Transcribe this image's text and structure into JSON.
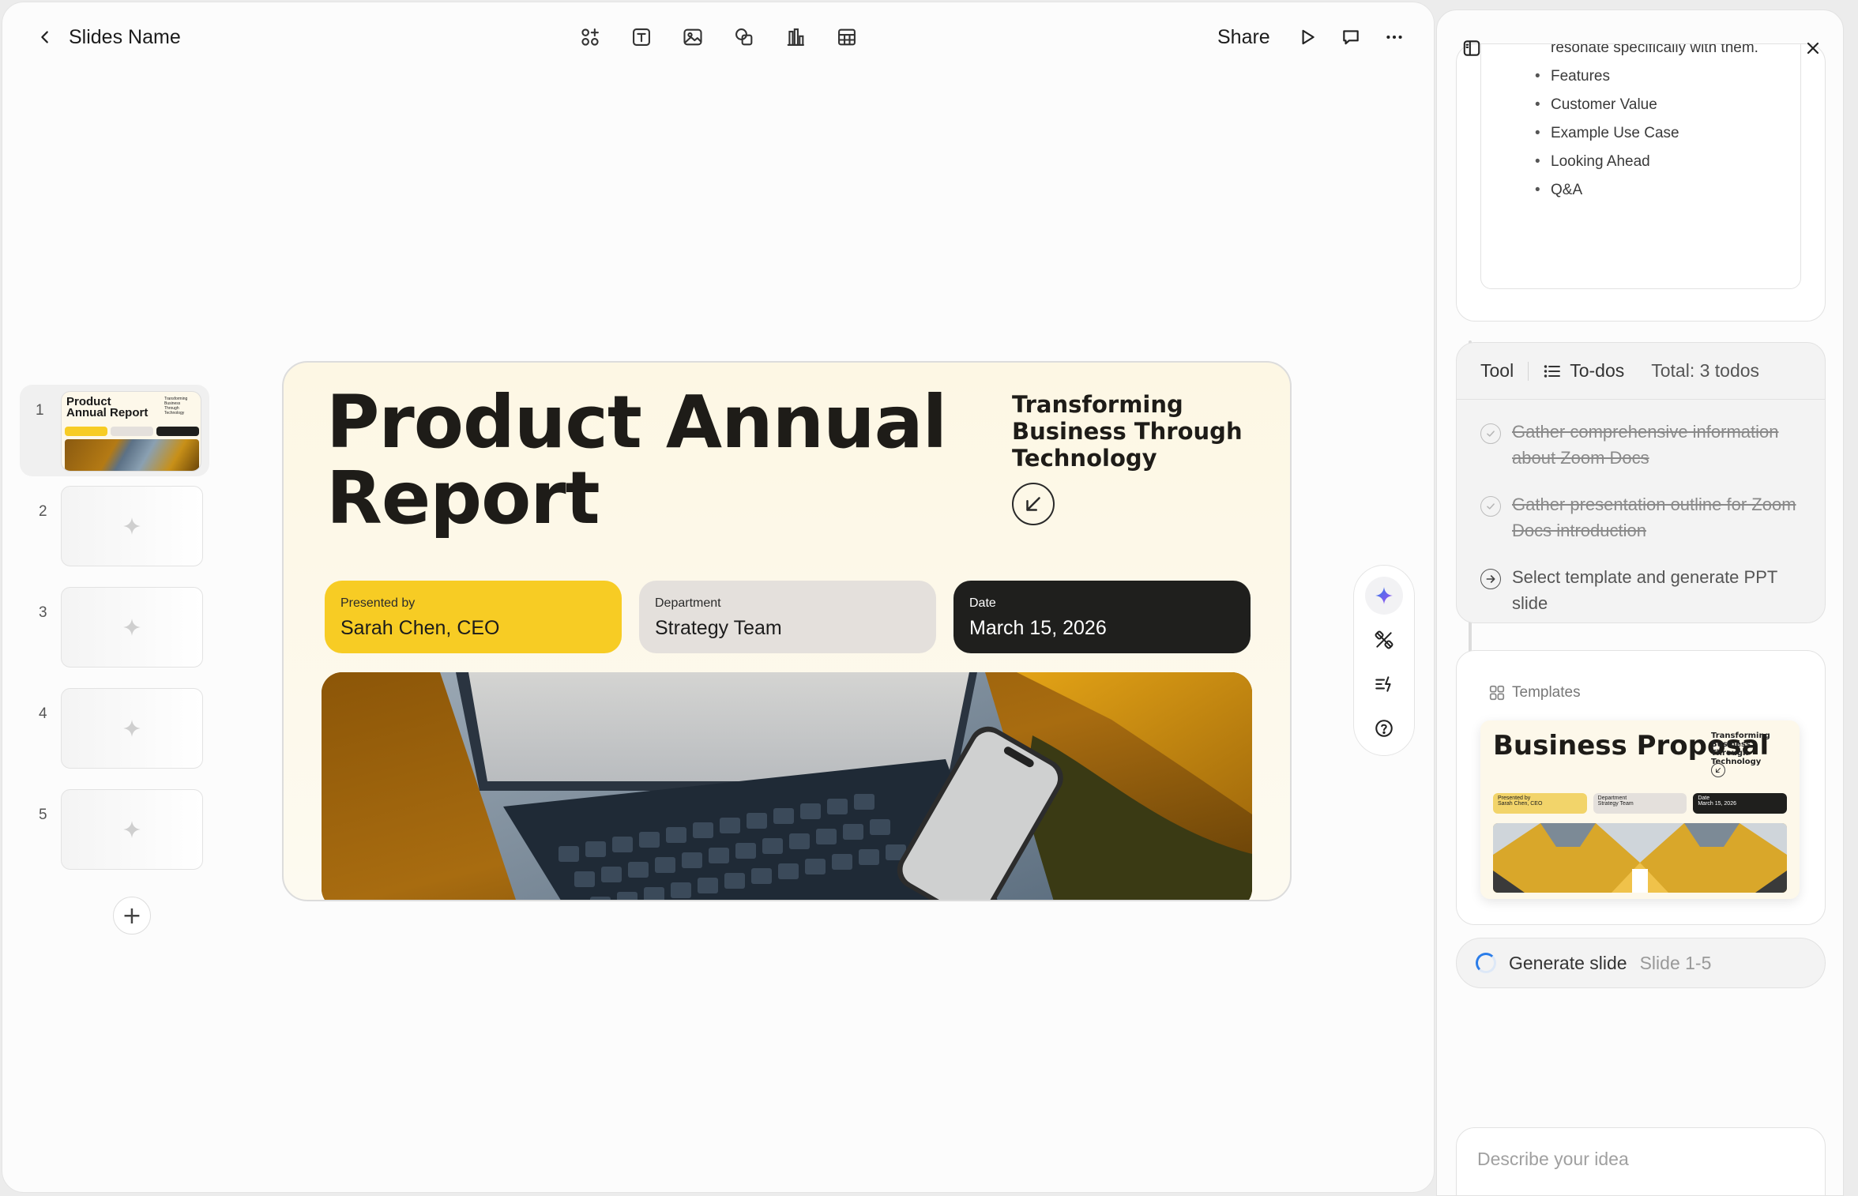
{
  "header": {
    "back_icon": "chevron-left-icon",
    "title": "Slides Name",
    "tools": [
      "components-icon",
      "text-box-icon",
      "image-icon",
      "shapes-icon",
      "chart-icon",
      "table-icon"
    ],
    "share_label": "Share",
    "right_icons": [
      "play-icon",
      "comment-icon",
      "more-icon"
    ]
  },
  "thumbnails": {
    "items": [
      {
        "number": "1",
        "title": "Product Annual Report",
        "subtitle": "Transforming Business Through Technology",
        "active": true
      },
      {
        "number": "2"
      },
      {
        "number": "3"
      },
      {
        "number": "4"
      },
      {
        "number": "5"
      }
    ],
    "add_icon": "plus-icon",
    "add_label": "+"
  },
  "slide": {
    "title": "Product Annual Report",
    "subtitle": "Transforming Business Through Technology",
    "pills": [
      {
        "label": "Presented by",
        "value": "Sarah Chen, CEO",
        "color": "#f7cc24"
      },
      {
        "label": "Department",
        "value": "Strategy Team",
        "color": "#e4e0dc"
      },
      {
        "label": "Date",
        "value": "March 15, 2026",
        "color": "#1f1f1d"
      }
    ]
  },
  "ai_toolbar": {
    "icons": [
      "ai-sparkle-icon",
      "design-tools-icon",
      "quick-actions-icon",
      "help-icon"
    ]
  },
  "panel": {
    "outline_items": [
      "Use language and examples that resonate specifically with them.",
      "Features",
      "Customer Value",
      "Example Use Case",
      "Looking Ahead",
      "Q&A"
    ],
    "todo": {
      "tool_label": "Tool",
      "todos_label": "To-dos",
      "total_label": "Total: 3 todos",
      "items": [
        {
          "text": "Gather comprehensive information about Zoom Docs",
          "done": true
        },
        {
          "text": "Gather presentation outline for Zoom Docs introduction",
          "done": true
        },
        {
          "text": "Select template and generate PPT slide",
          "done": false
        }
      ]
    },
    "templates": {
      "label": "Templates",
      "preview": {
        "title": "Business Proposal",
        "subtitle": "Transforming Business Through Technology",
        "pills": [
          {
            "label": "Presented by",
            "value": "Sarah Chen, CEO"
          },
          {
            "label": "Department",
            "value": "Strategy Team"
          },
          {
            "label": "Date",
            "value": "March 15, 2026"
          }
        ]
      }
    },
    "generate": {
      "label": "Generate slide",
      "range": "Slide 1-5"
    },
    "prompt_placeholder": "Describe your idea"
  },
  "colors": {
    "accent_yellow": "#f7cc24",
    "dark": "#1f1f1d",
    "ai_blue": "#2b7de9"
  }
}
